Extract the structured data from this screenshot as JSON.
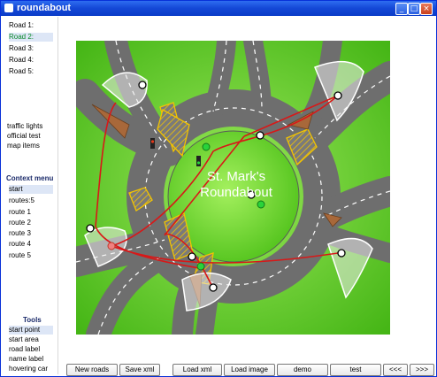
{
  "window": {
    "title": "roundabout",
    "minimize": "_",
    "maximize": "□",
    "close": "×"
  },
  "sidebar": {
    "roads": [
      "Road 1:",
      "Road 2:",
      "Road 3:",
      "Road 4:",
      "Road 5:"
    ],
    "options": [
      "traffic lights",
      "official test",
      "map items"
    ],
    "context_menu_label": "Context menu",
    "context_items": [
      "start",
      "routes:5",
      "route 1",
      "route 2",
      "route 3",
      "route 4",
      "route 5"
    ],
    "tools_label": "Tools",
    "tools": [
      "start point",
      "start area",
      "road label",
      "name label",
      "hovering car"
    ]
  },
  "map": {
    "label": "St. Mark's Roundabout",
    "label_line1": "St. Mark's",
    "label_line2": "Roundabout",
    "colors": {
      "grass": "#66cc22",
      "road": "#6e6e6e",
      "route": "#d81818",
      "yellow": "#f3c400",
      "brown": "#a8683a"
    }
  },
  "buttons": [
    "New roads",
    "Save xml",
    "Load xml",
    "Load image",
    "demo",
    "test",
    "<<<",
    ">>>"
  ]
}
